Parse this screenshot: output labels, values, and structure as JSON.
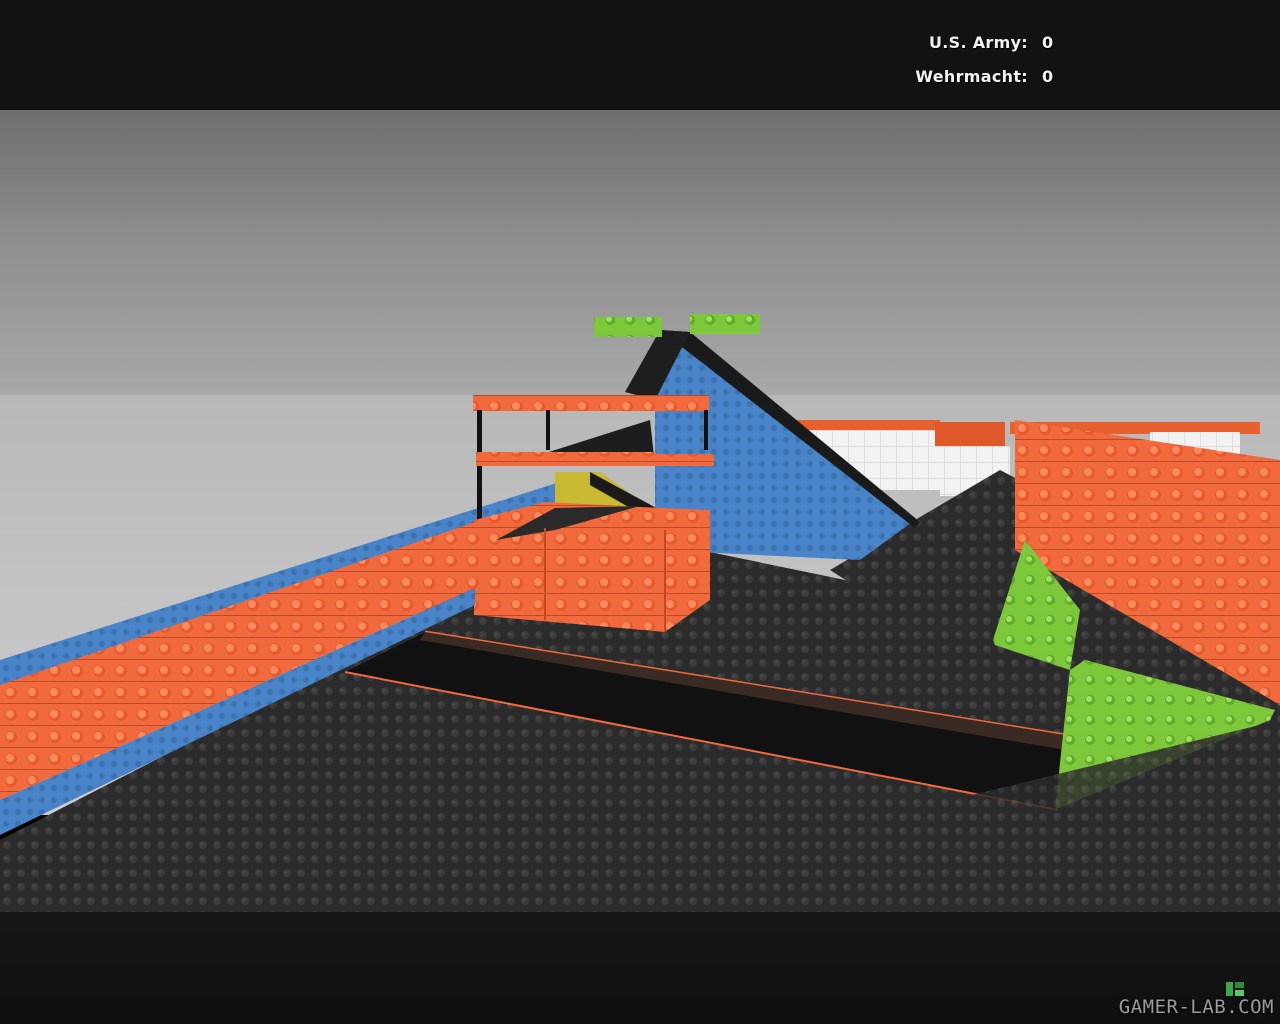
{
  "scoreboard": {
    "teams": [
      {
        "name": "U.S. Army:",
        "score": "0"
      },
      {
        "name": "Wehrmacht:",
        "score": "0"
      }
    ]
  },
  "watermark": {
    "text": "GAMER-LAB.COM",
    "icon": "green-logo-icon"
  },
  "colors": {
    "brick_orange": "#f06a3e",
    "brick_blue": "#4a84c8",
    "brick_green": "#7cc83a",
    "brick_yellow": "#c8b832",
    "floor_dark": "#2a2a2a",
    "sky": "#8c8c8c"
  }
}
